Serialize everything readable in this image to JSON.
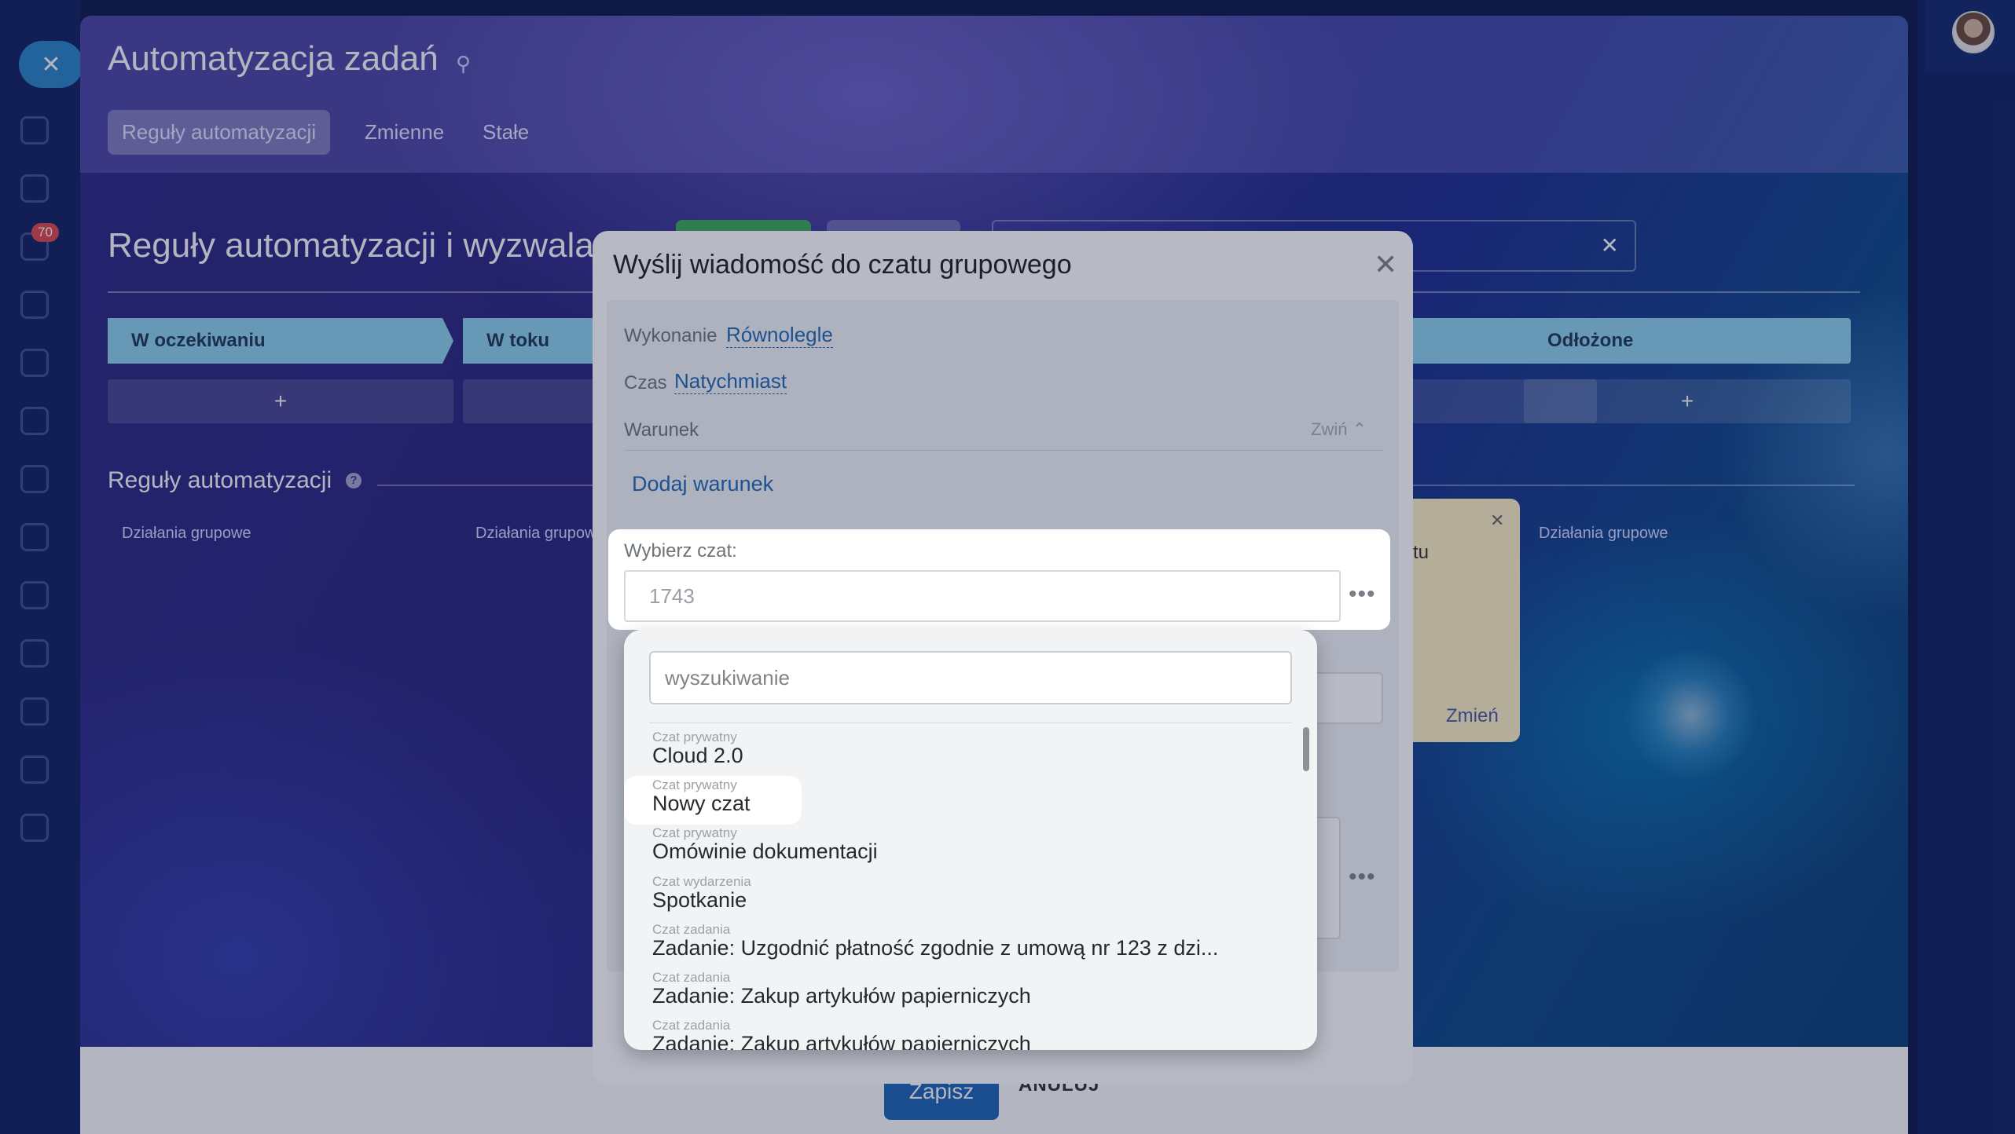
{
  "app": {
    "notifications_badge": "70"
  },
  "panel": {
    "title": "Automatyzacja zadań",
    "tabs": [
      {
        "label": "Reguły automatyzacji",
        "active": true
      },
      {
        "label": "Zmienne",
        "active": false
      },
      {
        "label": "Stałe",
        "active": false
      }
    ],
    "section_title": "Reguły automatyzacji i wyzwala",
    "stages": [
      {
        "label": "W oczekiwaniu",
        "color": "#8fd6f2"
      },
      {
        "label": "W toku",
        "color": "#8fd6f2"
      },
      {
        "label": "Odłożone",
        "color": "#8fd6f2"
      }
    ],
    "stage_add": "+",
    "rules_label": "Reguły automatyzacji",
    "group_actions": "Działania grupowe",
    "card_text": "tu",
    "card_change": "Zmień",
    "save": "Zapisz",
    "cancel": "ANULUJ"
  },
  "dialog": {
    "title": "Wyślij wiadomość do czatu grupowego",
    "execution_label": "Wykonanie",
    "execution_value": "Równolegle",
    "time_label": "Czas",
    "time_value": "Natychmiast",
    "condition_label": "Warunek",
    "collapse_label": "Zwiń",
    "add_condition": "Dodaj warunek",
    "choose_chat_label": "Wybierz czat:",
    "choose_chat_value": "1743",
    "more": "•••"
  },
  "dropdown": {
    "search_placeholder": "wyszukiwanie",
    "items": [
      {
        "type": "Czat prywatny",
        "name": "Cloud 2.0"
      },
      {
        "type": "Czat prywatny",
        "name": "Nowy czat",
        "highlighted": true
      },
      {
        "type": "Czat prywatny",
        "name": "Omówinie dokumentacji"
      },
      {
        "type": "Czat wydarzenia",
        "name": "Spotkanie"
      },
      {
        "type": "Czat zadania",
        "name": "Zadanie: Uzgodnić płatność zgodnie z umową nr 123 z dzi..."
      },
      {
        "type": "Czat zadania",
        "name": "Zadanie: Zakup artykułów papierniczych"
      },
      {
        "type": "Czat zadania",
        "name": "Zadanie: Zakup artykułów papierniczych"
      }
    ]
  }
}
